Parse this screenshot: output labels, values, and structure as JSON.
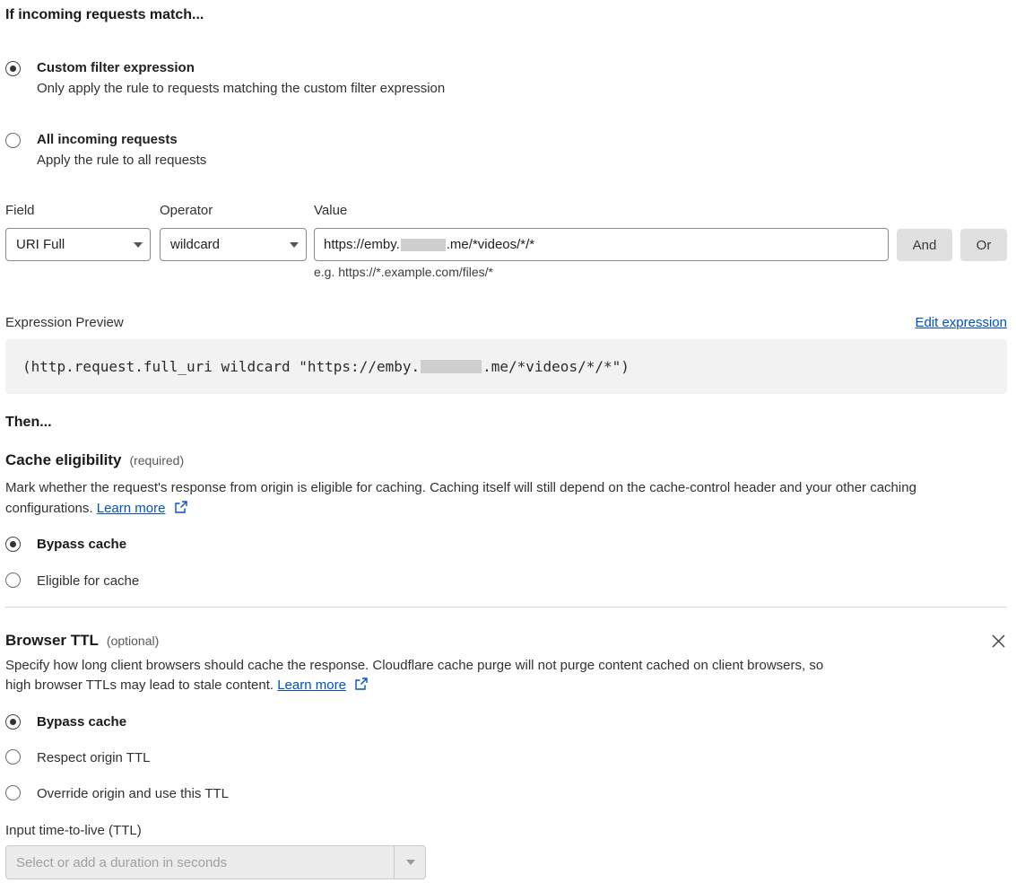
{
  "section_if": {
    "title": "If incoming requests match..."
  },
  "match_options": [
    {
      "label": "Custom filter expression",
      "description": "Only apply the rule to requests matching the custom filter expression",
      "selected": true
    },
    {
      "label": "All incoming requests",
      "description": "Apply the rule to all requests",
      "selected": false
    }
  ],
  "filter": {
    "field_label": "Field",
    "operator_label": "Operator",
    "value_label": "Value",
    "field_value": "URI Full",
    "operator_value": "wildcard",
    "value_prefix": "https://emby.",
    "value_suffix": ".me/*videos/*/*",
    "value_hint": "e.g. https://*.example.com/files/*",
    "and_button": "And",
    "or_button": "Or"
  },
  "expression": {
    "label": "Expression Preview",
    "edit_link": "Edit expression",
    "code_prefix": "(http.request.full_uri wildcard \"https://emby.",
    "code_suffix": ".me/*videos/*/*\")"
  },
  "section_then": {
    "title": "Then..."
  },
  "cache_eligibility": {
    "title": "Cache eligibility",
    "tag": "(required)",
    "description_line1": "Mark whether the request's response from origin is eligible for caching. Caching itself will still depend on the cache-control header and your other caching",
    "description_line2": "configurations.",
    "learn_more": "Learn more",
    "options": [
      {
        "label": "Bypass cache",
        "selected": true
      },
      {
        "label": "Eligible for cache",
        "selected": false
      }
    ]
  },
  "browser_ttl": {
    "title": "Browser TTL",
    "tag": "(optional)",
    "description_line1": "Specify how long client browsers should cache the response. Cloudflare cache purge will not purge content cached on client browsers, so",
    "description_line2": "high browser TTLs may lead to stale content.",
    "learn_more": "Learn more",
    "options": [
      {
        "label": "Bypass cache",
        "selected": true
      },
      {
        "label": "Respect origin TTL",
        "selected": false
      },
      {
        "label": "Override origin and use this TTL",
        "selected": false
      }
    ],
    "ttl_label": "Input time-to-live (TTL)",
    "ttl_placeholder": "Select or add a duration in seconds"
  }
}
